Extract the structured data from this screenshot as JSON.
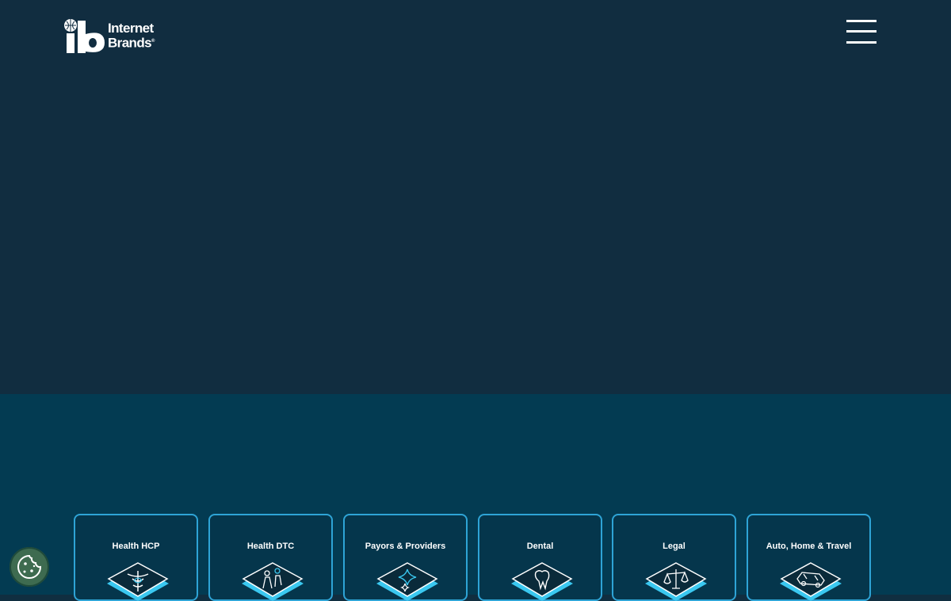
{
  "header": {
    "logo": {
      "line1": "Internet",
      "line2": "Brands"
    },
    "menu_icon": "hamburger-menu-icon"
  },
  "verticals": [
    {
      "label": "Health HCP",
      "icon": "caduceus-icon"
    },
    {
      "label": "Health DTC",
      "icon": "family-icon"
    },
    {
      "label": "Payors & Providers",
      "icon": "sparkle-icon"
    },
    {
      "label": "Dental",
      "icon": "tooth-icon"
    },
    {
      "label": "Legal",
      "icon": "scales-icon"
    },
    {
      "label": "Auto, Home & Travel",
      "icon": "car-icon"
    }
  ],
  "cookie_button": {
    "icon": "cookie-icon"
  },
  "colors": {
    "hero_bg": "#112d40",
    "section_bg": "#033b52",
    "card_border": "#2ea4d6",
    "accent": "#3ac8f0"
  }
}
